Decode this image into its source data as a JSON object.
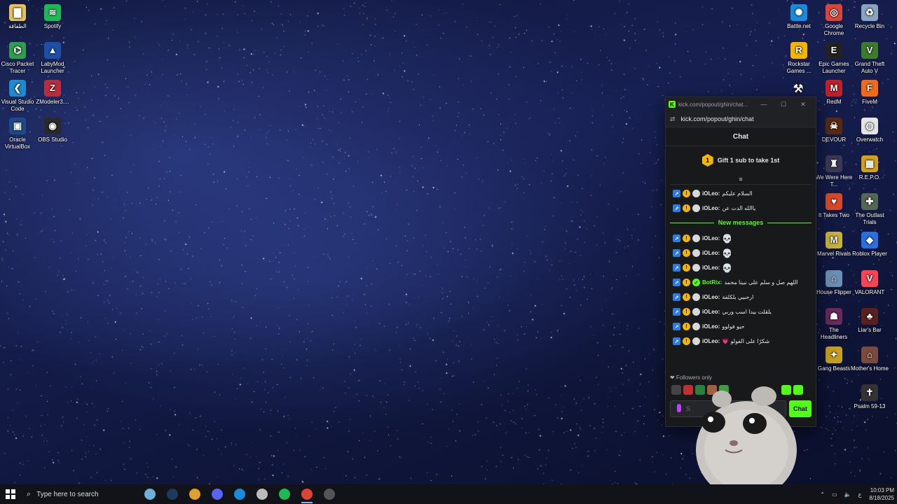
{
  "desktop": {
    "left_icons": [
      {
        "label": "الطفاقة",
        "icon": "folder-icon",
        "color": "#e8c25a",
        "glyph": "▇"
      },
      {
        "label": "Spotify",
        "icon": "spotify-icon",
        "color": "#1db954",
        "glyph": "≋"
      },
      {
        "label": "Cisco Packet Tracer",
        "icon": "cisco-packet-tracer-icon",
        "color": "#2e9e4f",
        "glyph": "⌬"
      },
      {
        "label": "LabyMod Launcher",
        "icon": "labymod-icon",
        "color": "#1e4fa8",
        "glyph": "▲"
      },
      {
        "label": "Visual Studio Code",
        "icon": "vscode-icon",
        "color": "#1f8ad2",
        "glyph": "❮"
      },
      {
        "label": "ZModeler3....",
        "icon": "zmodeler-icon",
        "color": "#b82d3c",
        "glyph": "Z"
      },
      {
        "label": "Oracle VirtualBox",
        "icon": "virtualbox-icon",
        "color": "#1b4b8a",
        "glyph": "▣"
      },
      {
        "label": "OBS Studio",
        "icon": "obs-icon",
        "color": "#2a2a2a",
        "glyph": "◉"
      }
    ],
    "right_icons": [
      {
        "label": "Battle.net",
        "icon": "battlenet-icon",
        "color": "#1a8bdb",
        "glyph": "✺"
      },
      {
        "label": "Google Chrome",
        "icon": "chrome-icon",
        "color": "#db4437",
        "glyph": "◎"
      },
      {
        "label": "Recycle Bin",
        "icon": "recycle-bin-icon",
        "color": "#8aa4c0",
        "glyph": "♻"
      },
      {
        "label": "Rockstar Games ...",
        "icon": "rockstar-icon",
        "color": "#f4b400",
        "glyph": "R"
      },
      {
        "label": "Epic Games Launcher",
        "icon": "epic-games-icon",
        "color": "#222",
        "glyph": "E"
      },
      {
        "label": "Grand Theft Auto V",
        "icon": "gta-icon",
        "color": "#3c7a2c",
        "glyph": "V"
      },
      {
        "label": "RedM",
        "icon": "redm-icon",
        "color": "#c0202a",
        "glyph": "M"
      },
      {
        "label": "FiveM",
        "icon": "fivem-icon",
        "color": "#f06a1a",
        "glyph": "F"
      },
      {
        "label": "DEVOUR",
        "icon": "devour-icon",
        "color": "#5a2a10",
        "glyph": "☠"
      },
      {
        "label": "Overwatch",
        "icon": "overwatch-icon",
        "color": "#e5e5e5",
        "glyph": "◍"
      },
      {
        "label": "We Were Here T...",
        "icon": "we-were-here-icon",
        "color": "#3a3a55",
        "glyph": "♜"
      },
      {
        "label": "R.E.P.O.",
        "icon": "repo-icon",
        "color": "#d2a21a",
        "glyph": "▦"
      },
      {
        "label": "It Takes Two",
        "icon": "it-takes-two-icon",
        "color": "#d64a2a",
        "glyph": "♥"
      },
      {
        "label": "The Outlast Trials",
        "icon": "outlast-trials-icon",
        "color": "#556655",
        "glyph": "✚"
      },
      {
        "label": "Marvel Rivals",
        "icon": "marvel-rivals-icon",
        "color": "#c9b23a",
        "glyph": "M"
      },
      {
        "label": "Roblox Player",
        "icon": "roblox-icon",
        "color": "#2a6fe0",
        "glyph": "◆"
      },
      {
        "label": "House Flipper",
        "icon": "house-flipper-icon",
        "color": "#6b8fb5",
        "glyph": "⌂"
      },
      {
        "label": "VALORANT",
        "icon": "valorant-icon",
        "color": "#fa4454",
        "glyph": "V"
      },
      {
        "label": "The Headliners",
        "icon": "headliners-icon",
        "color": "#6a2a5a",
        "glyph": "☗"
      },
      {
        "label": "Liar's Bar",
        "icon": "liars-bar-icon",
        "color": "#5a2020",
        "glyph": "♣"
      },
      {
        "label": "Gang Beasts",
        "icon": "gang-beasts-icon",
        "color": "#c8a020",
        "glyph": "✦"
      },
      {
        "label": "Mother's Home",
        "icon": "mothers-home-icon",
        "color": "#7a4a3a",
        "glyph": "⌂"
      },
      {
        "label": "Psalm 59-13",
        "icon": "psalm-icon",
        "color": "#333",
        "glyph": "✝"
      }
    ],
    "extra_icon": {
      "icon": "tool-icon",
      "glyph": "⚒"
    }
  },
  "chat_window": {
    "title_text": "kick.com/popout/ghin/chat...",
    "url": "kick.com/popout/ghin/chat",
    "favicon_letter": "K",
    "header": "Chat",
    "gift_badge": "1",
    "gift_text": "Gift 1 sub to take 1st",
    "scroll_glyph": "≡",
    "new_messages_label": "New messages",
    "messages_before": [
      {
        "user": "iOLeo:",
        "text": "السلام عليكم"
      },
      {
        "user": "iOLeo:",
        "text": "ياالله الدت عن"
      }
    ],
    "messages_after": [
      {
        "user": "iOLeo:",
        "text": "💀",
        "type": "emote"
      },
      {
        "user": "iOLeo:",
        "text": "💀",
        "type": "emote"
      },
      {
        "user": "iOLeo:",
        "text": "💀",
        "type": "emote"
      },
      {
        "user": "BotRix:",
        "text": "اللهم صل و سلم على نبينا محمد",
        "type": "bot"
      },
      {
        "user": "iOLeo:",
        "text": "ارحبيي بلكلفة",
        "type": "text"
      },
      {
        "user": "iOLeo:",
        "text": "يلقلت بيدا اسب وربي",
        "type": "text"
      },
      {
        "user": "iOLeo:",
        "text": "حيو فولوو",
        "type": "text"
      },
      {
        "user": "iOLeo:",
        "text": "شكرًا على الفولو 💗",
        "type": "text"
      }
    ],
    "followers_only": "❤ Followers only",
    "input_placeholder": "S",
    "chat_button": "Chat",
    "colors": {
      "accent": "#53fc18",
      "bg": "#18191b",
      "sub_badge": "#f2b705"
    }
  },
  "taskbar": {
    "search_placeholder": "Type here to search",
    "tray_lang": "ع",
    "clock_time": "10:03 PM",
    "clock_date": "8/18/2025",
    "apps": [
      {
        "name": "weather-widget",
        "color": "#6fb0d6"
      },
      {
        "name": "steam",
        "color": "#1b3a5c"
      },
      {
        "name": "unknown-app",
        "color": "#e0a030"
      },
      {
        "name": "discord",
        "color": "#5865f2"
      },
      {
        "name": "battlenet",
        "color": "#1a8bdb"
      },
      {
        "name": "settings-app",
        "color": "#bbbbbb"
      },
      {
        "name": "spotify",
        "color": "#1db954"
      },
      {
        "name": "chrome",
        "color": "#db4437",
        "active": true
      },
      {
        "name": "obs",
        "color": "#555555"
      }
    ]
  }
}
